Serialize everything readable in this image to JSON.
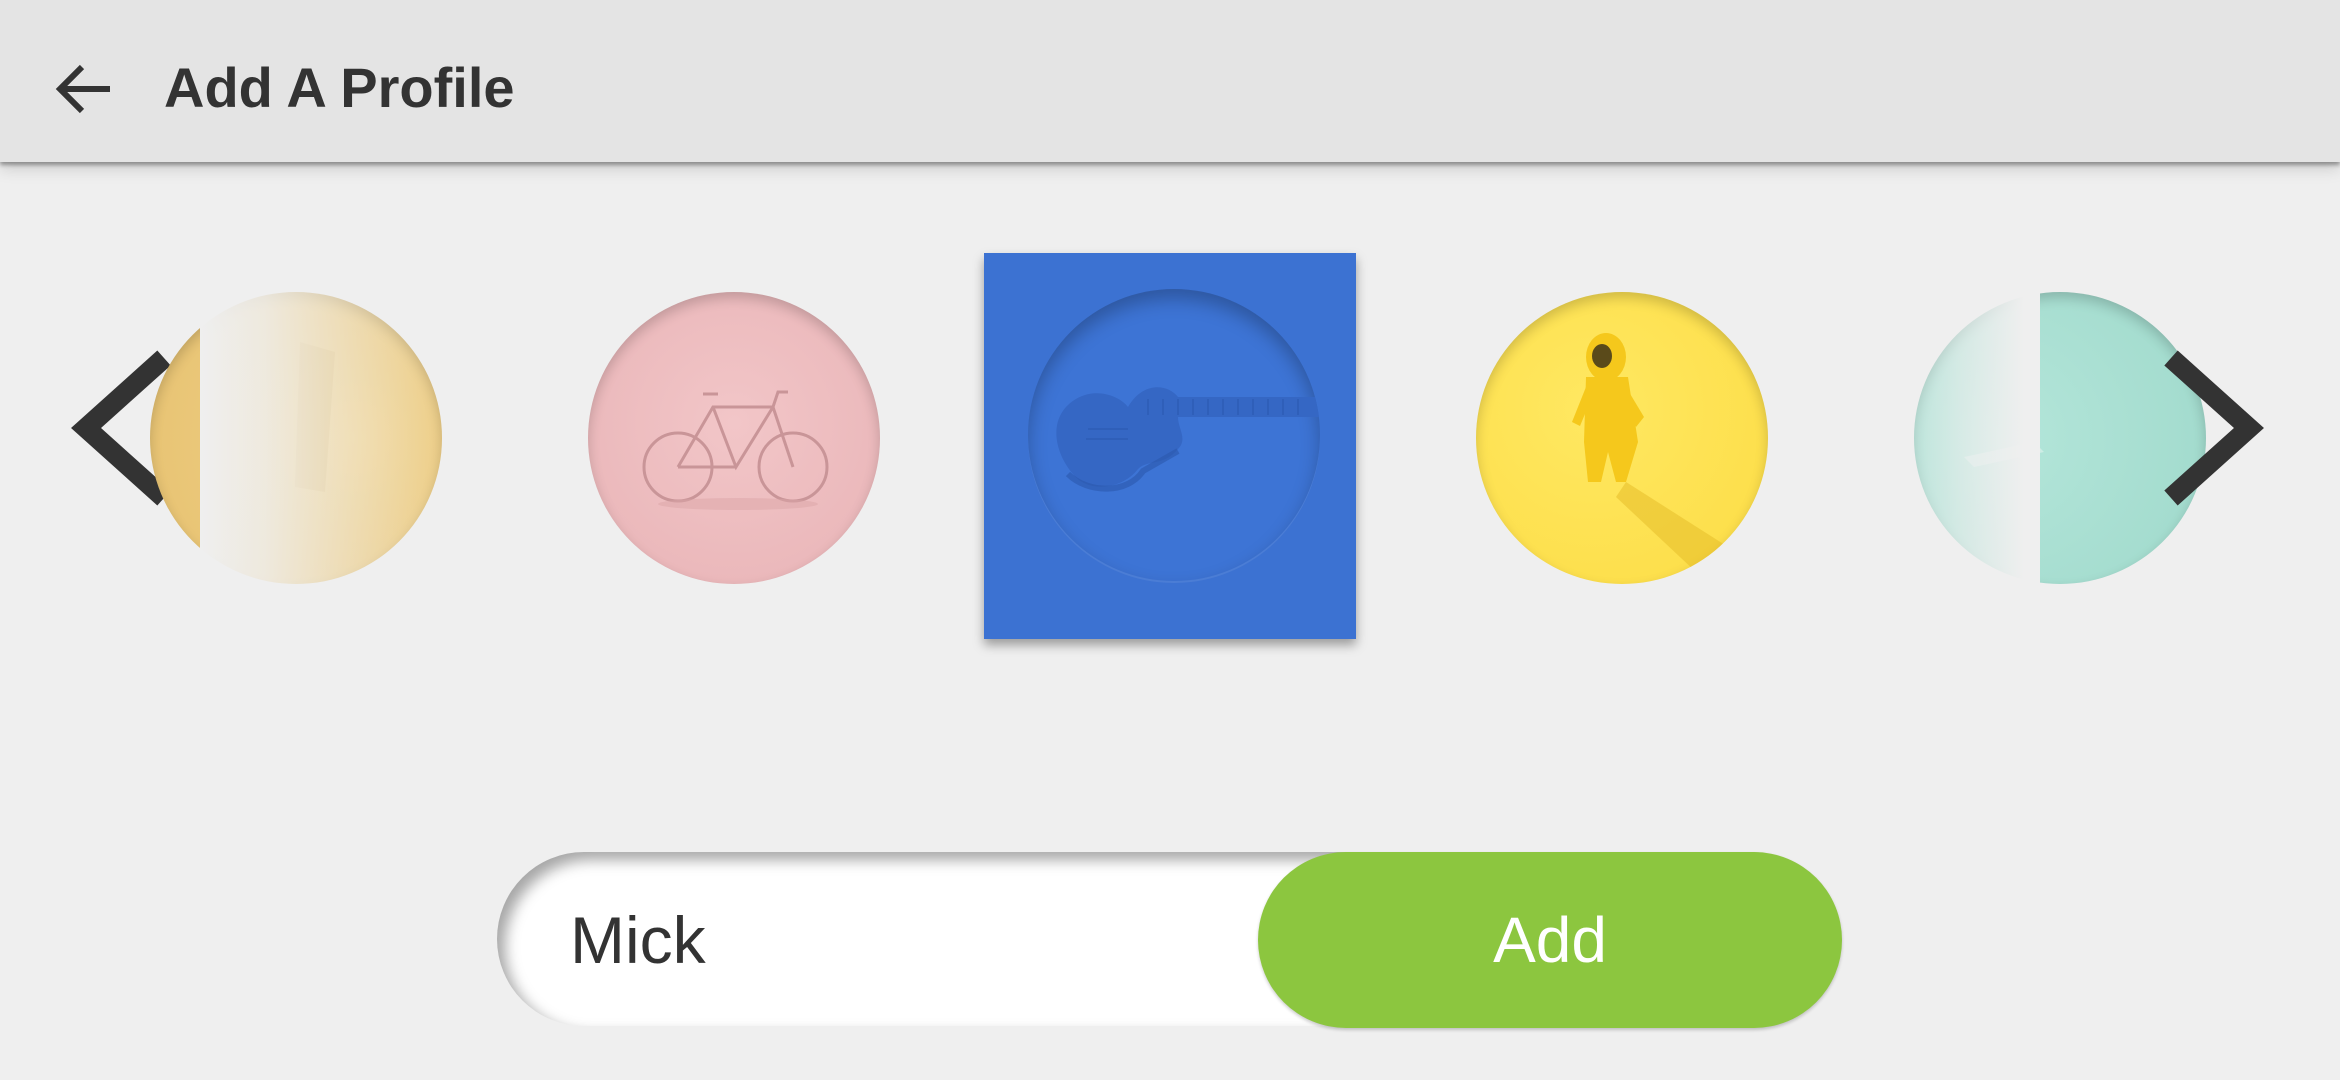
{
  "header": {
    "title": "Add A Profile",
    "back_icon": "arrow-back-icon"
  },
  "carousel": {
    "prev_icon": "chevron-left-icon",
    "next_icon": "chevron-right-icon",
    "avatars": [
      {
        "name": "partial-avatar-left",
        "color": "#eccb7a",
        "icon": "object-icon"
      },
      {
        "name": "bicycle-avatar",
        "color": "#eebcbe",
        "icon": "bicycle-icon"
      },
      {
        "name": "guitar-avatar",
        "color": "#3c72d2",
        "icon": "guitar-icon",
        "selected": true
      },
      {
        "name": "hazmat-suit-avatar",
        "color": "#fde04f",
        "icon": "hazmat-suit-icon"
      },
      {
        "name": "partial-avatar-right",
        "color": "#a9e0d3",
        "icon": "object-icon"
      }
    ]
  },
  "form": {
    "name_value": "Mick",
    "add_label": "Add"
  },
  "colors": {
    "accent": "#8cc63f",
    "selected_bg": "#3c72d2",
    "appbar_bg": "#e4e4e4",
    "page_bg": "#efefef"
  }
}
